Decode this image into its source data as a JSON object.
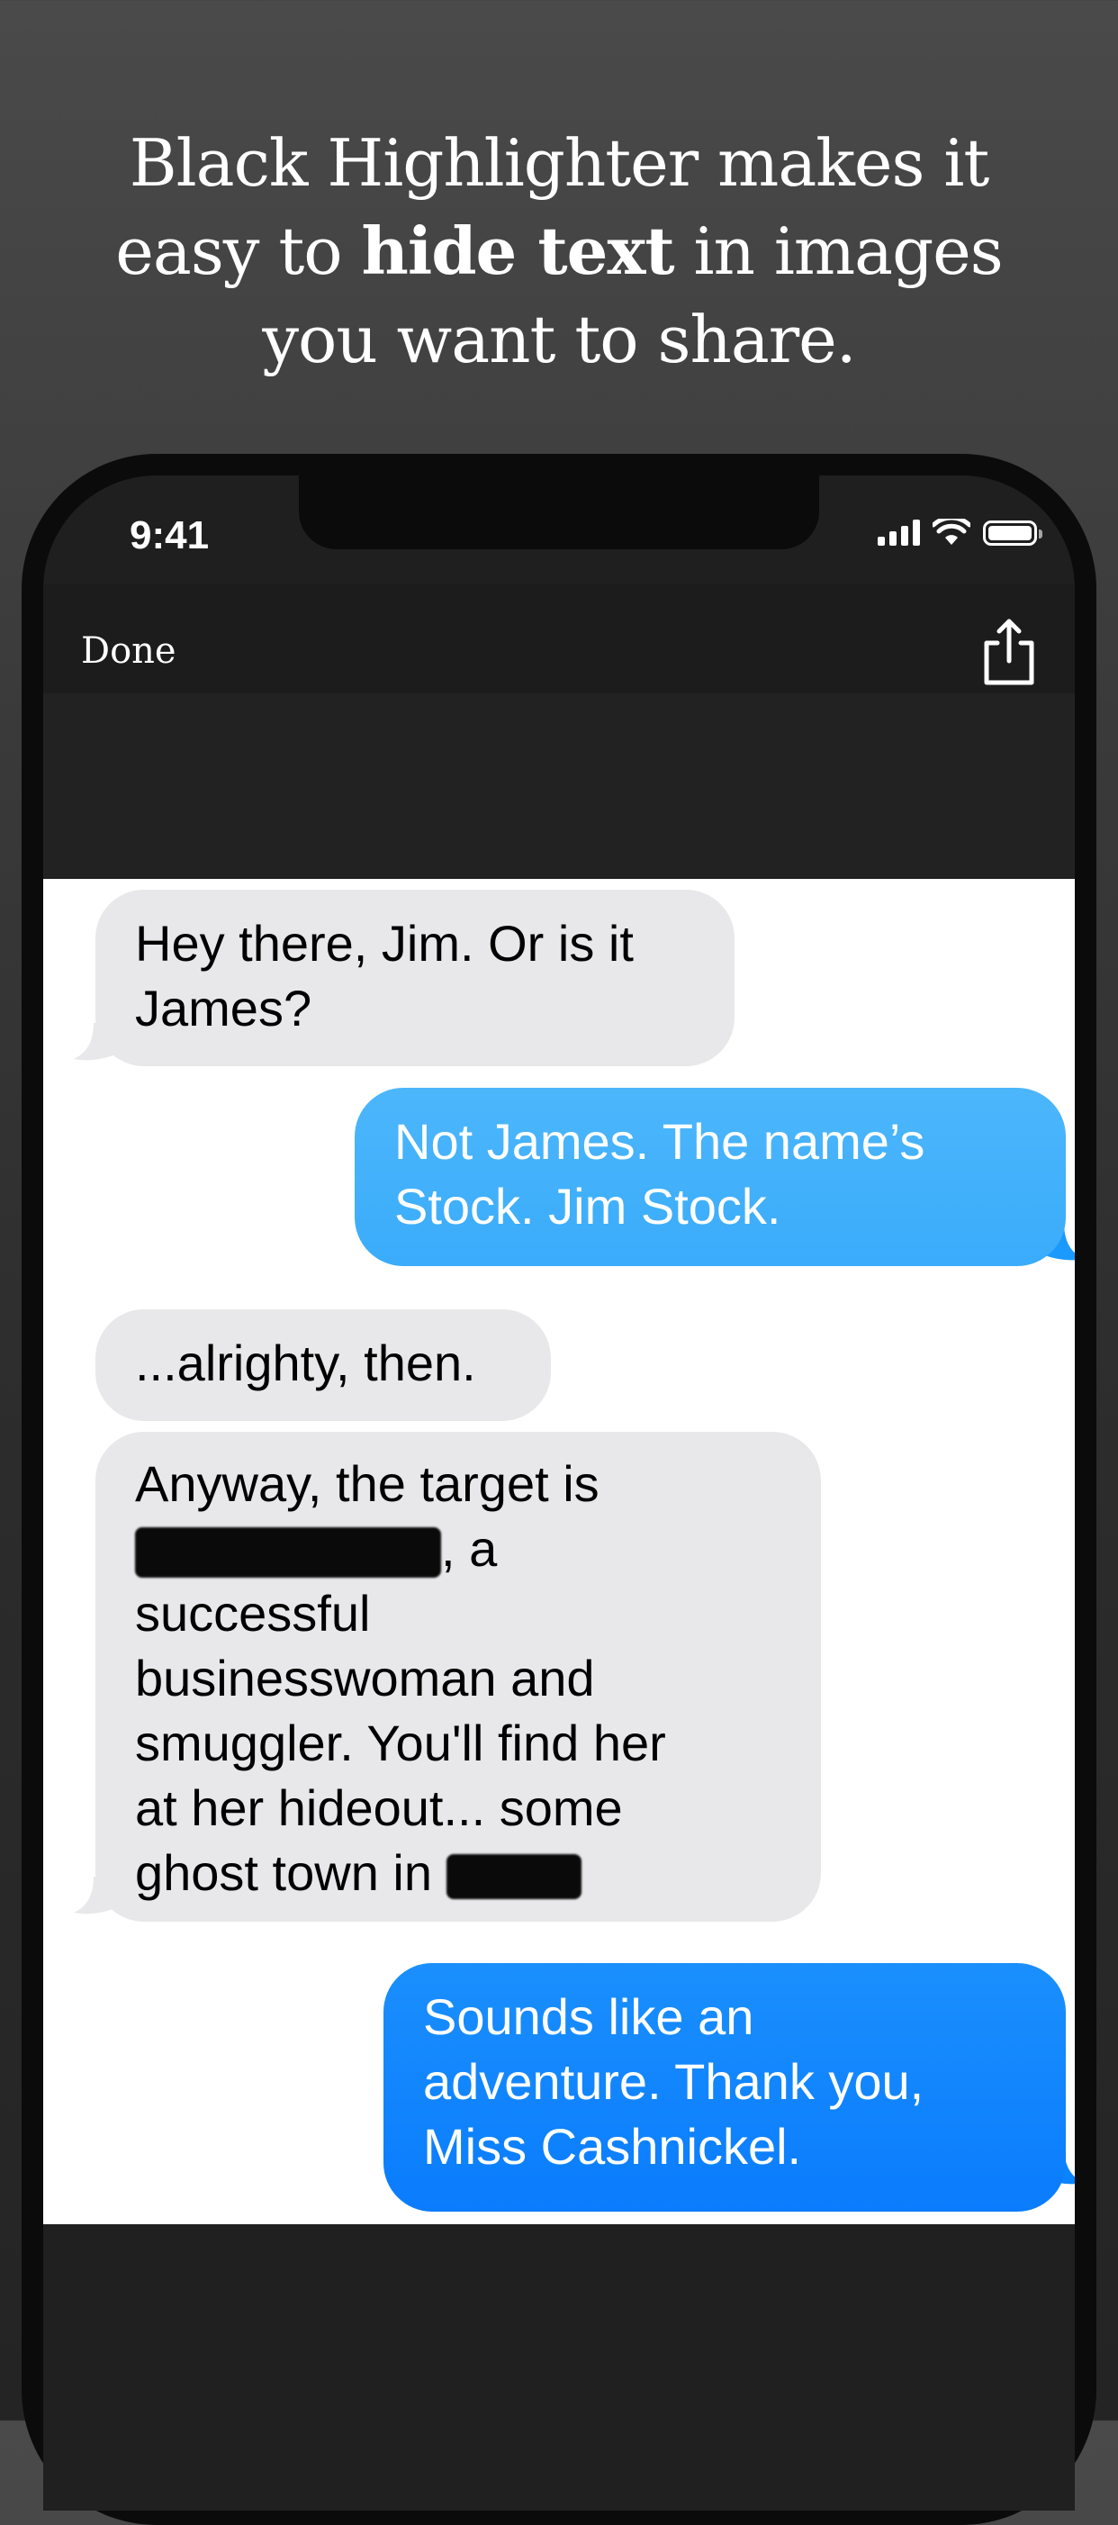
{
  "headline": {
    "line1": "Black Highlighter makes it",
    "line2_before": "easy to ",
    "line2_bold": "hide text",
    "line2_after": " in images",
    "line3": "you want to share."
  },
  "status_bar": {
    "time": "9:41",
    "icons": [
      "cellular-signal-icon",
      "wifi-icon",
      "battery-icon"
    ]
  },
  "navbar": {
    "done_label": "Done",
    "share_icon": "share-icon"
  },
  "messages": [
    {
      "side": "received",
      "lines": [
        "Hey there, Jim. Or is it",
        "James?"
      ]
    },
    {
      "side": "sent",
      "lines": [
        "Not James. The name’s",
        "Stock. Jim Stock."
      ]
    },
    {
      "side": "received",
      "lines": [
        "...alrighty, then."
      ]
    },
    {
      "side": "received",
      "line1": "Anyway, the target is",
      "line2_suffix": ", a",
      "line3": "successful",
      "line4": "businesswoman and",
      "line5": "smuggler. You'll find her",
      "line6": "at her hideout... some",
      "line7": "ghost town in"
    },
    {
      "side": "sent",
      "lines": [
        "Sounds like an",
        "adventure. Thank you,",
        "Miss Cashnickel."
      ]
    }
  ],
  "colors": {
    "sent_bubble_top": "#4cb6fb",
    "sent_bubble_bottom": "#0a84ff",
    "received_bubble": "#e8e8ea",
    "redaction": "#0a0a0a"
  }
}
